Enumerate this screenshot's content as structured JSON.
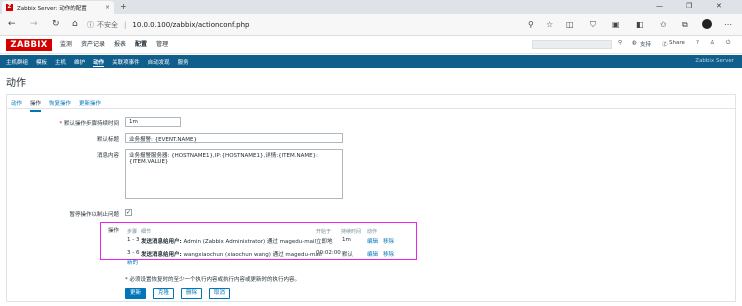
{
  "browser": {
    "tab_title": "Zabbix Server: 动作的配置",
    "tab_close": "×",
    "new_tab": "+",
    "insecure_text": "不安全",
    "separator": "|",
    "url": "10.0.0.100/zabbix/actionconf.php",
    "window_controls": [
      "—",
      "❐",
      "✕"
    ],
    "nav": {
      "back": "←",
      "forward": "→",
      "refresh": "↻",
      "home": "⌂"
    }
  },
  "zabbix": {
    "logo": "ZABBIX",
    "top_menu": [
      {
        "label": "监测",
        "active": false
      },
      {
        "label": "资产记录",
        "active": false
      },
      {
        "label": "报表",
        "active": false
      },
      {
        "label": "配置",
        "active": true
      },
      {
        "label": "管理",
        "active": false
      }
    ],
    "support": "支持",
    "share": "Share",
    "help": "?",
    "sub_menu": [
      {
        "label": "主机群组",
        "active": false
      },
      {
        "label": "模板",
        "active": false
      },
      {
        "label": "主机",
        "active": false
      },
      {
        "label": "维护",
        "active": false
      },
      {
        "label": "动作",
        "active": true
      },
      {
        "label": "关联项事件",
        "active": false
      },
      {
        "label": "自动发现",
        "active": false
      },
      {
        "label": "服务",
        "active": false
      }
    ],
    "server_name": "Zabbix Server"
  },
  "page": {
    "title": "动作",
    "tabs": [
      {
        "label": "动作",
        "active": false
      },
      {
        "label": "操作",
        "active": true
      },
      {
        "label": "恢复操作",
        "active": false
      },
      {
        "label": "更新操作",
        "active": false
      }
    ],
    "form": {
      "step_duration_label": "默认操作步骤持续时间",
      "step_duration_required": "*",
      "step_duration_value": "1m",
      "subject_label": "默认标题",
      "subject_value": "业务报警: {EVENT.NAME}",
      "message_label": "消息内容",
      "message_line1": "业务报警服务器: {HOSTNAME1},IP:{HOSTNAME1},详情:{ITEM.NAME}:",
      "message_line2": "{ITEM.VALUE}",
      "pause_label": "暂停操作以制止问题",
      "pause_checked": "✓"
    },
    "operations": {
      "label": "操作",
      "headers": [
        "步骤",
        "细节",
        "开始于",
        "持续时间",
        "动作"
      ],
      "rows": [
        {
          "steps": "1 - 3",
          "detail_bold": "发送消息给用户:",
          "detail_rest": "Admin (Zabbix Administrator) 通过 magedu-mail",
          "start": "立即地",
          "duration": "1m",
          "edit": "编辑",
          "remove": "移除"
        },
        {
          "steps": "3 - 6",
          "detail_bold": "发送消息给用户:",
          "detail_rest": "wangxiaochun (xiaochun wang) 通过 magedu-mail",
          "start": "00:02:00",
          "duration": "默认",
          "edit": "编辑",
          "remove": "移除"
        }
      ],
      "new_link": "新的"
    },
    "note": "* 必须设置恢复时的至少一个执行内容或执行内容或更新时的执行内容。",
    "buttons": {
      "update": "更新",
      "clone": "克隆",
      "delete": "删除",
      "cancel": "取消"
    }
  },
  "colors": {
    "zabbix_red": "#d40000",
    "nav_blue": "#0f5e8c",
    "link_blue": "#0275b8",
    "highlight": "#ee22ee"
  }
}
